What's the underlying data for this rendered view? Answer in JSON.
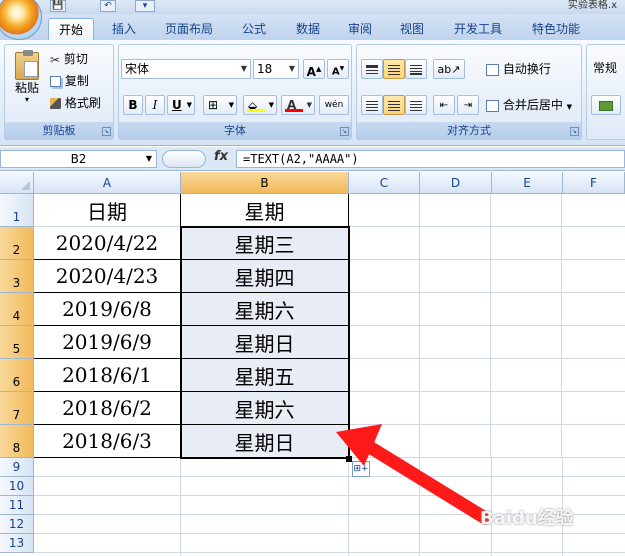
{
  "window": {
    "title": "实验表格.x",
    "qa_buttons": [
      "💾",
      "↶",
      "▾"
    ]
  },
  "tabs": [
    {
      "label": "开始",
      "active": true
    },
    {
      "label": "插入"
    },
    {
      "label": "页面布局"
    },
    {
      "label": "公式"
    },
    {
      "label": "数据"
    },
    {
      "label": "审阅"
    },
    {
      "label": "视图"
    },
    {
      "label": "开发工具"
    },
    {
      "label": "特色功能"
    }
  ],
  "ribbon": {
    "clipboard": {
      "label": "剪贴板",
      "paste": "粘贴",
      "cut": "剪切",
      "copy": "复制",
      "format_painter": "格式刷"
    },
    "font": {
      "label": "字体",
      "font_name": "宋体",
      "font_size": "18",
      "grow": "A",
      "shrink": "A",
      "bold": "B",
      "italic": "I",
      "underline": "U",
      "border": "⊞",
      "fill_color": "#ffff00",
      "font_color": "#ff0000",
      "font_color_glyph": "A",
      "phonetic": "wén"
    },
    "alignment": {
      "label": "对齐方式",
      "wrap_text": "自动换行",
      "merge_center": "合并后居中"
    },
    "number": {
      "label": "常规"
    }
  },
  "formula_bar": {
    "name_box": "B2",
    "fx": "fx",
    "formula": "=TEXT(A2,\"AAAA\")"
  },
  "sheet": {
    "columns": [
      "A",
      "B",
      "C",
      "D",
      "E",
      "F"
    ],
    "rows": [
      "1",
      "2",
      "3",
      "4",
      "5",
      "6",
      "7",
      "8",
      "9",
      "10",
      "11",
      "12",
      "13"
    ],
    "data": [
      [
        "日期",
        "星期"
      ],
      [
        "2020/4/22",
        "星期三"
      ],
      [
        "2020/4/23",
        "星期四"
      ],
      [
        "2019/6/8",
        "星期六"
      ],
      [
        "2019/6/9",
        "星期日"
      ],
      [
        "2018/6/1",
        "星期五"
      ],
      [
        "2018/6/2",
        "星期六"
      ],
      [
        "2018/6/3",
        "星期日"
      ]
    ],
    "selection": "B2:B8",
    "accent": "#f1b95b"
  },
  "overlay": {
    "arrow_color": "#ff1a1a",
    "watermark": "Baidu经验"
  }
}
